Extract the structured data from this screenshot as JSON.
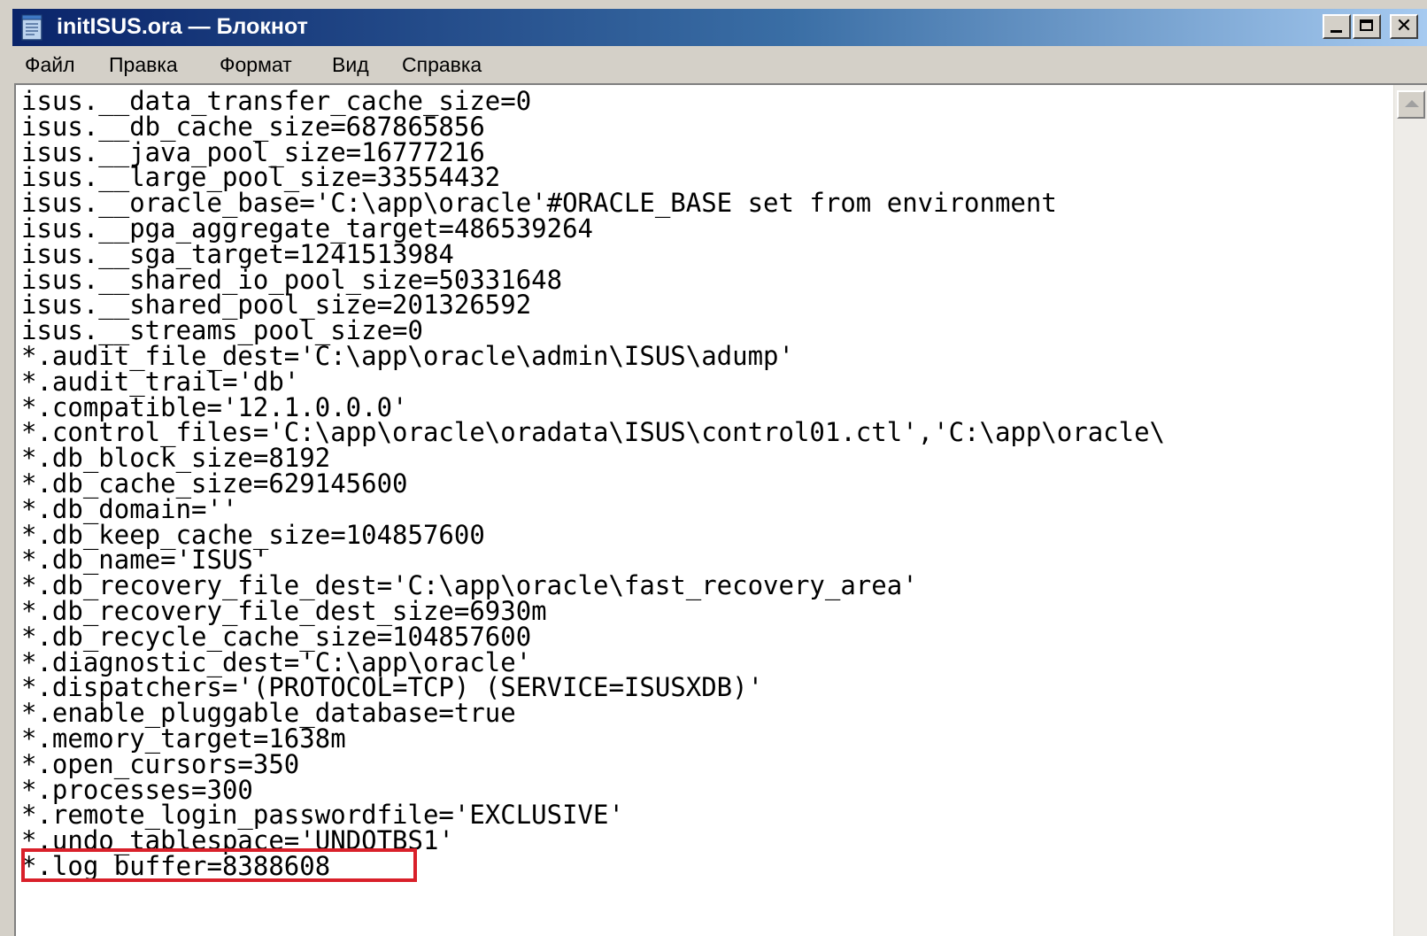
{
  "window": {
    "title": "initISUS.ora — Блокнот",
    "minimize_glyph": "_",
    "close_glyph": "✕",
    "icon": "notepad-icon"
  },
  "menu": {
    "items": [
      {
        "label": "Файл"
      },
      {
        "label": "Правка"
      },
      {
        "label": "Формат"
      },
      {
        "label": "Вид"
      },
      {
        "label": "Справка"
      }
    ]
  },
  "editor": {
    "lines": [
      "isus.__data_transfer_cache_size=0",
      "isus.__db_cache_size=687865856",
      "isus.__java_pool_size=16777216",
      "isus.__large_pool_size=33554432",
      "isus.__oracle_base='C:\\app\\oracle'#ORACLE_BASE set from environment",
      "isus.__pga_aggregate_target=486539264",
      "isus.__sga_target=1241513984",
      "isus.__shared_io_pool_size=50331648",
      "isus.__shared_pool_size=201326592",
      "isus.__streams_pool_size=0",
      "*.audit_file_dest='C:\\app\\oracle\\admin\\ISUS\\adump'",
      "*.audit_trail='db'",
      "*.compatible='12.1.0.0.0'",
      "*.control_files='C:\\app\\oracle\\oradata\\ISUS\\control01.ctl','C:\\app\\oracle\\",
      "*.db_block_size=8192",
      "*.db_cache_size=629145600",
      "*.db_domain=''",
      "*.db_keep_cache_size=104857600",
      "*.db_name='ISUS'",
      "*.db_recovery_file_dest='C:\\app\\oracle\\fast_recovery_area'",
      "*.db_recovery_file_dest_size=6930m",
      "*.db_recycle_cache_size=104857600",
      "*.diagnostic_dest='C:\\app\\oracle'",
      "*.dispatchers='(PROTOCOL=TCP) (SERVICE=ISUSXDB)'",
      "*.enable_pluggable_database=true",
      "*.memory_target=1638m",
      "*.open_cursors=350",
      "*.processes=300",
      "*.remote_login_passwordfile='EXCLUSIVE'",
      "*.undo_tablespace='UNDOTBS1'",
      "*.log_buffer=8388608"
    ],
    "highlighted_line": "*.log_buffer=8388608",
    "highlight_color": "#d9202a"
  }
}
